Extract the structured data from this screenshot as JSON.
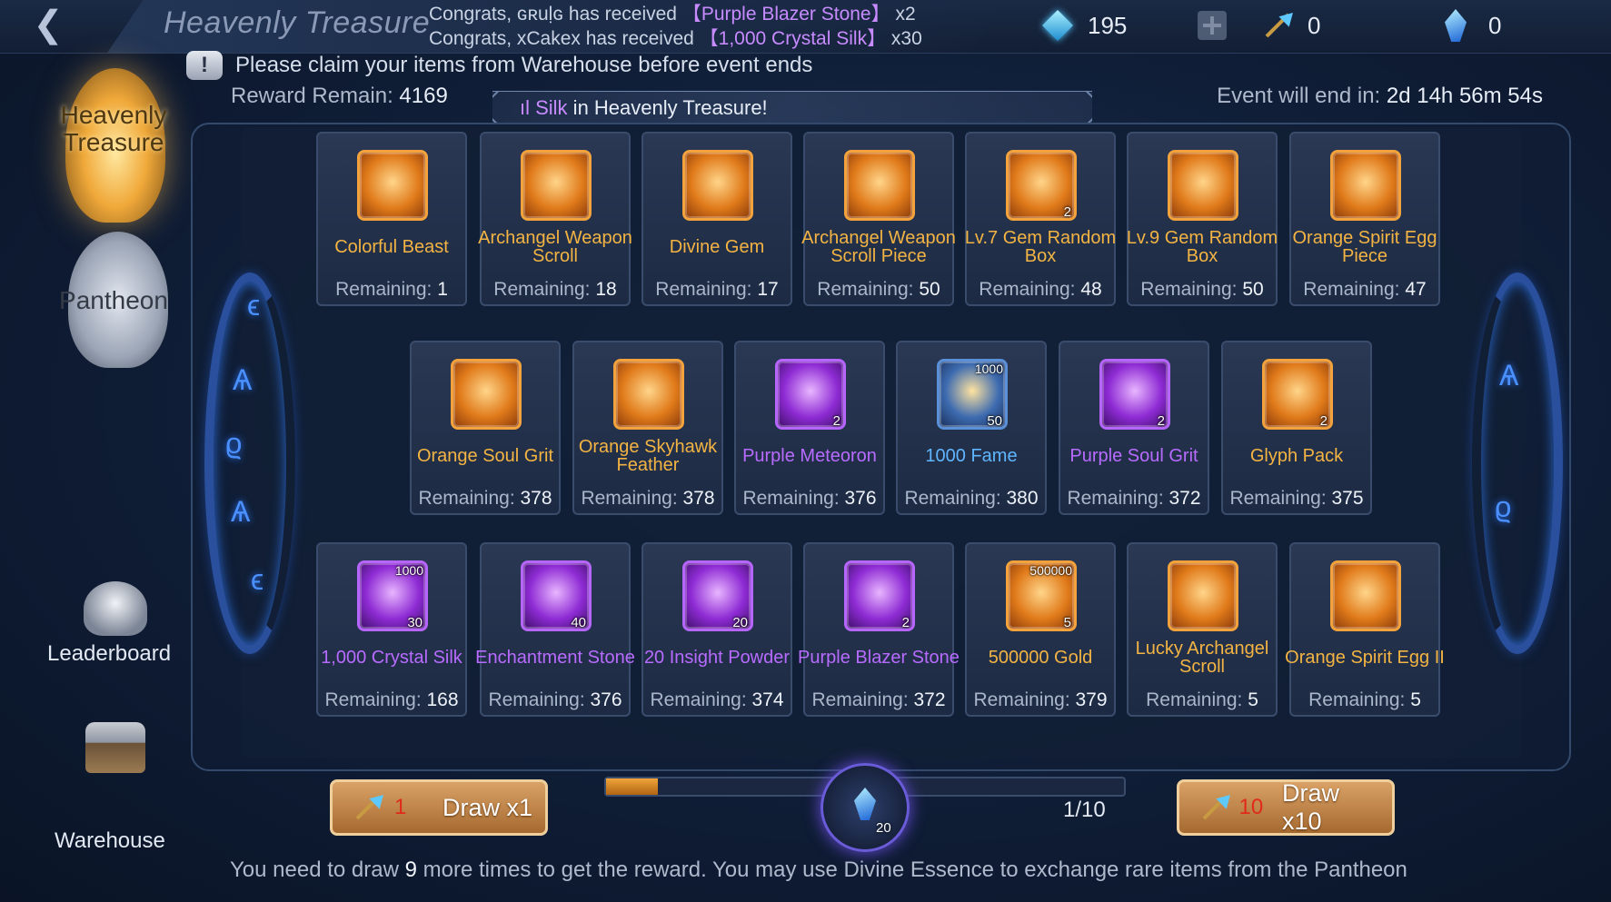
{
  "header": {
    "title": "Heavenly Treasure",
    "ticker": [
      {
        "prefix": "Congrats, ",
        "player": "ɢʀuḷɢ",
        "mid": " has received ",
        "item": "【Purple Blazer Stone】",
        "count": " x2"
      },
      {
        "prefix": "Congrats, ",
        "player": "xCakex",
        "mid": " has received ",
        "item": "【1,000 Crystal Silk】",
        "count": " x30"
      }
    ],
    "currencies": {
      "diamonds": "195",
      "arrows": "0",
      "crystals": "0"
    }
  },
  "notice": "Please claim your items from Warehouse before event ends",
  "reward_remain": {
    "label": "Reward Remain: ",
    "value": "4169"
  },
  "marquee": {
    "highlight": "ıl Silk",
    "text": " in Heavenly Treasure!"
  },
  "event_end": {
    "label": "Event will end in: ",
    "value": "2d 14h 56m 54s"
  },
  "sidebar": {
    "heavenly": "Heavenly Treasure",
    "pantheon": "Pantheon",
    "leaderboard": "Leaderboard",
    "warehouse": "Warehouse"
  },
  "remaining_label": "Remaining: ",
  "rewards": [
    {
      "name": "Colorful Beast",
      "remaining": "1",
      "rarity": "orange"
    },
    {
      "name": "Archangel Weapon Scroll",
      "remaining": "18",
      "rarity": "orange"
    },
    {
      "name": "Divine Gem",
      "remaining": "17",
      "rarity": "orange"
    },
    {
      "name": "Archangel Weapon Scroll Piece",
      "remaining": "50",
      "rarity": "orange"
    },
    {
      "name": "Lv.7 Gem Random Box",
      "remaining": "48",
      "rarity": "orange",
      "qty": "2"
    },
    {
      "name": "Lv.9 Gem Random Box",
      "remaining": "50",
      "rarity": "orange"
    },
    {
      "name": "Orange Spirit Egg Piece",
      "remaining": "47",
      "rarity": "orange"
    },
    {
      "name": "Orange Soul Grit",
      "remaining": "378",
      "rarity": "orange"
    },
    {
      "name": "Orange Skyhawk Feather",
      "remaining": "378",
      "rarity": "orange"
    },
    {
      "name": "Purple Meteoron",
      "remaining": "376",
      "rarity": "purple",
      "qty": "2"
    },
    {
      "name": "1000 Fame",
      "remaining": "380",
      "rarity": "blue",
      "top": "1000",
      "qty": "50"
    },
    {
      "name": "Purple Soul Grit",
      "remaining": "372",
      "rarity": "purple",
      "qty": "2"
    },
    {
      "name": "Glyph Pack",
      "remaining": "375",
      "rarity": "orange",
      "qty": "2"
    },
    {
      "name": "1,000 Crystal Silk",
      "remaining": "168",
      "rarity": "purple",
      "top": "1000",
      "qty": "30"
    },
    {
      "name": "Enchantment Stone",
      "remaining": "376",
      "rarity": "purple",
      "qty": "40"
    },
    {
      "name": "20 Insight Powder",
      "remaining": "374",
      "rarity": "purple",
      "qty": "20"
    },
    {
      "name": "Purple Blazer Stone",
      "remaining": "372",
      "rarity": "purple",
      "qty": "2"
    },
    {
      "name": "500000 Gold",
      "remaining": "379",
      "rarity": "orange",
      "top": "500000",
      "qty": "5"
    },
    {
      "name": "Lucky Archangel Scroll",
      "remaining": "5",
      "rarity": "orange"
    },
    {
      "name": "Orange Spirit Egg II",
      "remaining": "5",
      "rarity": "orange"
    }
  ],
  "draw": {
    "x1": {
      "cost": "1",
      "label": "Draw x1"
    },
    "x10": {
      "cost": "10",
      "label": "Draw x10"
    },
    "progress": 0.1,
    "count": "1/10",
    "orb_qty": "20"
  },
  "bottom_text": {
    "a": "You need to draw ",
    "n": "9",
    "b": " more times to get the reward. You may use Divine Essence to exchange rare items from the Pantheon"
  }
}
